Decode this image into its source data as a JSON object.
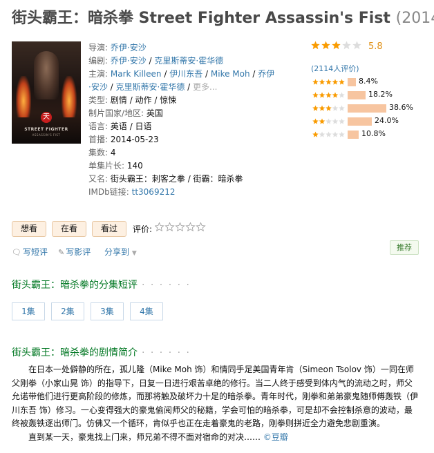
{
  "title": {
    "main": "街头霸王：暗杀拳 Street Fighter Assassin's Fist",
    "year": "(2014)"
  },
  "poster": {
    "logo": "STREET FIGHTER",
    "sub": "ASSASSIN'S FIST",
    "badge": "天"
  },
  "info": {
    "director_label": "导演:",
    "director": "乔伊·安沙",
    "writer_label": "编剧:",
    "writers": [
      "乔伊·安沙",
      "克里斯蒂安·霍华德"
    ],
    "cast_label": "主演:",
    "cast_line1": [
      "Mark Killeen",
      "伊川东吾",
      "Mike Moh",
      "乔伊"
    ],
    "cast_line2": [
      "·安沙",
      "克里斯蒂安·霍华德",
      "更多..."
    ],
    "genre_label": "类型:",
    "genre": "剧情 / 动作 / 惊悚",
    "country_label": "制片国家/地区:",
    "country": "英国",
    "language_label": "语言:",
    "language": "英语 / 日语",
    "premiere_label": "首播:",
    "premiere": "2014-05-23",
    "episodes_label": "集数:",
    "episodes": "4",
    "length_label": "单集片长:",
    "length": "140",
    "aka_label": "又名:",
    "aka": "街头霸王：刺客之拳 / 街霸：暗杀拳",
    "imdb_label": "IMDb链接:",
    "imdb": "tt3069212"
  },
  "rating": {
    "score": "5.8",
    "stars_value": 3,
    "count_text": "(2114人评价)",
    "rows": [
      {
        "stars": 5,
        "pct": 8.4,
        "label": "8.4%"
      },
      {
        "stars": 4,
        "pct": 18.2,
        "label": "18.2%"
      },
      {
        "stars": 3,
        "pct": 38.6,
        "label": "38.6%"
      },
      {
        "stars": 2,
        "pct": 24.0,
        "label": "24.0%"
      },
      {
        "stars": 1,
        "pct": 10.8,
        "label": "10.8%"
      }
    ],
    "colors": {
      "star": "#f99b01",
      "star_empty": "#ddd",
      "bar": "#f7c5a0",
      "score": "#e09015"
    }
  },
  "actions": {
    "want": "想看",
    "watching": "在看",
    "watched": "看过",
    "rate_label": "评价:",
    "short_review": "写短评",
    "long_review": "写影评",
    "share": "分享到",
    "recommend": "推荐"
  },
  "episode_section": {
    "title": "街头霸王：暗杀拳的分集短评",
    "dots": "· · · · · ·",
    "episodes": [
      "1集",
      "2集",
      "3集",
      "4集"
    ]
  },
  "synopsis_section": {
    "title": "街头霸王：暗杀拳的剧情简介",
    "dots": "· · · · · ·",
    "para1": "在日本一处僻静的所在，孤儿隆（Mike Moh 饰）和情同手足美国青年肯（Simeon Tsolov 饰）一同在师父刚拳（小家山晃 饰）的指导下，日复一日进行艰苦卓绝的修行。当二人终于感受到体内气的流动之时，师父允诺带他们进行更高阶段的修炼，而那将触及破坏力十足的暗杀拳。青年时代，刚拳和弟弟豪鬼随师傅轰铁（伊川东吾 饰）修习。一心变得强大的豪鬼偷阅师父的秘籍，学会可怕的暗杀拳，可是却不会控制杀意的波动，最终被轰铁逐出师门。仿佛又一个循环，肯似乎也正在走着豪鬼的老路，刚拳则拼近全力避免悲剧重演。",
    "para2": "直到某一天，豪鬼找上门来，师兄弟不得不面对宿命的对决……",
    "source": "©豆瓣"
  }
}
